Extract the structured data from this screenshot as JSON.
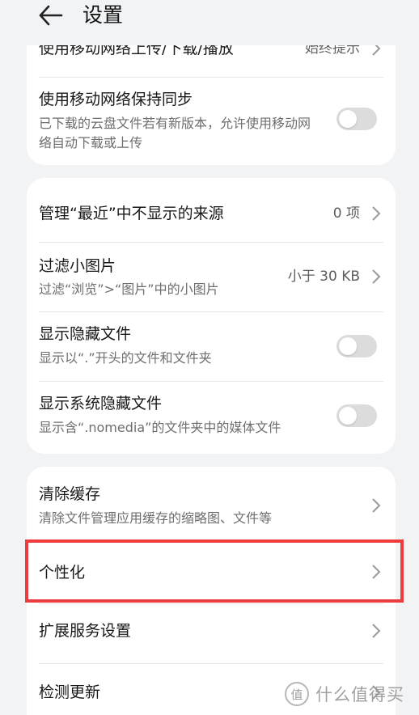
{
  "header": {
    "title": "设置",
    "back_icon": "arrow-left-icon"
  },
  "cards": {
    "network": {
      "upload_row": {
        "title": "使用移动网络上传/下载/播放",
        "value": "始终提示"
      },
      "sync_row": {
        "title": "使用移动网络保持同步",
        "subtitle": "已下载的云盘文件若有新版本，允许使用移动网络自动下载或上传",
        "enabled": false
      }
    },
    "display": {
      "recent_sources": {
        "title": "管理“最近”中不显示的来源",
        "value": "0 项"
      },
      "filter_images": {
        "title": "过滤小图片",
        "subtitle": "过滤“浏览”>“图片”中的小图片",
        "value": "小于 30 KB"
      },
      "hidden_files": {
        "title": "显示隐藏文件",
        "subtitle": "显示以“.”开头的文件和文件夹",
        "enabled": false
      },
      "system_hidden": {
        "title": "显示系统隐藏文件",
        "subtitle": "显示含“.nomedia”的文件夹中的媒体文件",
        "enabled": false
      }
    },
    "misc": {
      "clear_cache": {
        "title": "清除缓存",
        "subtitle": "清除文件管理应用缓存的缩略图、文件等"
      },
      "personalize": {
        "title": "个性化"
      },
      "extension_services": {
        "title": "扩展服务设置"
      },
      "check_updates": {
        "title": "检测更新"
      }
    }
  },
  "watermark": {
    "glyph": "值",
    "text": "什么值得买"
  },
  "colors": {
    "background": "#f1f3f5",
    "card": "#ffffff",
    "highlight": "#ee3b3e",
    "toggle_off": "#dcdcdc"
  }
}
